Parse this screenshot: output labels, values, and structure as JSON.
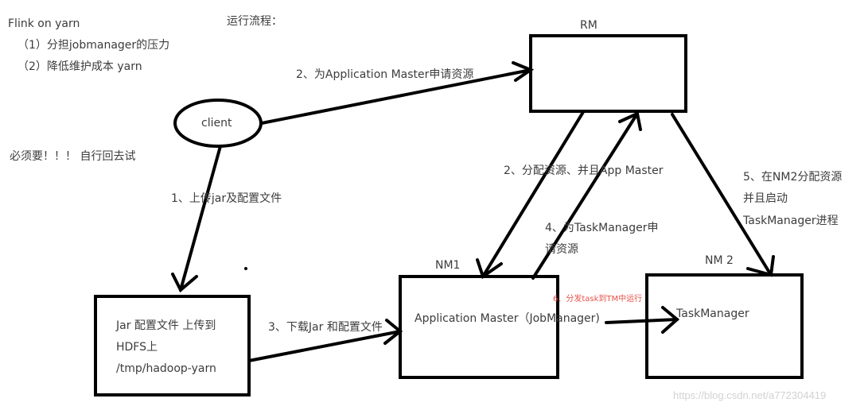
{
  "notes": {
    "title": "Flink on yarn",
    "point1": "（1）分担jobmanager的压力",
    "point2": "（2）降低维护成本  yarn",
    "must": "必须要！！！   自行回去试",
    "flow_heading": "运行流程："
  },
  "nodes": {
    "client": "client",
    "rm": "RM",
    "nm1": "NM1",
    "nm2": "NM 2",
    "hdfs_line1": "Jar 配置文件   上传到",
    "hdfs_line2": "HDFS上",
    "hdfs_line3": "/tmp/hadoop-yarn",
    "app_master": "Application Master（JobManager)",
    "task_manager": "TaskManager"
  },
  "steps": {
    "step1": "1、上传jar及配置文件",
    "step2a": "2、为Application Master申请资源",
    "step2b": "2、分配资源、并且App Master",
    "step3": "3、下载Jar 和配置文件",
    "step4_line1": "4、为TaskManager申",
    "step4_line2": "请资源",
    "step5_line1": "5、在NM2分配资源",
    "step5_line2": "并且启动",
    "step5_line3": "TaskManager进程",
    "step6": "6、分发task到TM中运行"
  },
  "watermark": "https://blog.csdn.net/a772304419",
  "colors": {
    "stroke": "#000000",
    "text": "#3c3c3c",
    "highlight": "#e8524a",
    "watermark": "#d2d2d2"
  }
}
